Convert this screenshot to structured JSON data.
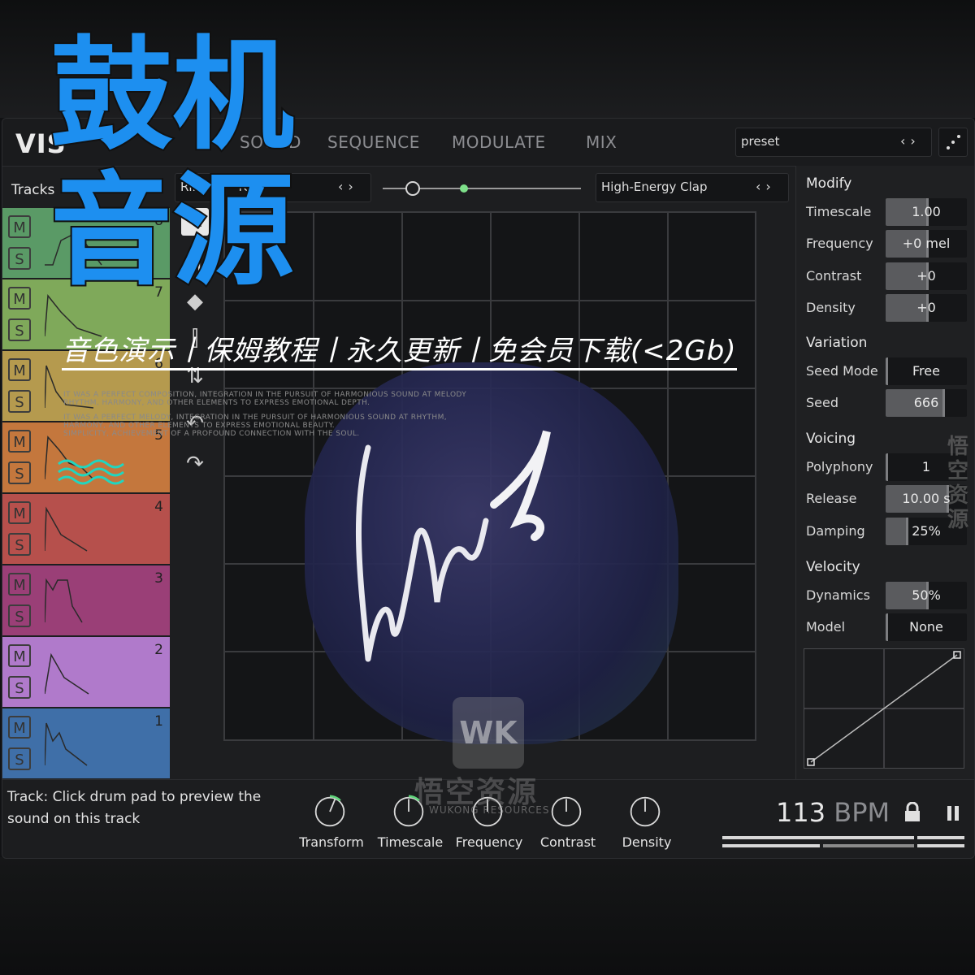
{
  "app": {
    "logo": "VIS",
    "tabs": [
      "SOUND",
      "SEQUENCE",
      "MODULATE",
      "MIX"
    ],
    "preset": {
      "value": "preset"
    }
  },
  "overlay": {
    "title_line1": "鼓机",
    "title_line2": "音源",
    "promo": "音色演示丨保姆教程丨永久更新丨免会员下载(<2Gb)",
    "small_text": [
      "IT WAS A PERFECT COMPOSITION, INTEGRATION IN THE PURSUIT OF HARMONIOUS SOUND AT MELODY",
      "RHYTHM, HARMONY, AND OTHER ELEMENTS TO EXPRESS EMOTIONAL DEPTH.",
      "IT WAS A PERFECT MELODY, INTEGRATION IN THE PURSUIT OF HARMONIOUS SOUND AT RHYTHM,",
      "HARMONY, AND OTHER ELEMENTS TO EXPRESS EMOTIONAL BEAUTY.",
      "SIMPLICITY, ACHIEVEMENT OF A PROFOUND CONNECTION WITH THE SOUL."
    ],
    "watermark_vertical": "悟空资源",
    "watermark_logo": "WK",
    "watermark_text": "悟空资源",
    "watermark_sub": "WUKONG RESOURCES"
  },
  "tracks": {
    "title": "Tracks",
    "items": [
      {
        "number": "8",
        "color": "#5a9a66",
        "mute": "M",
        "solo": "S"
      },
      {
        "number": "7",
        "color": "#7fa95a",
        "mute": "M",
        "solo": "S"
      },
      {
        "number": "6",
        "color": "#b59a4e",
        "mute": "M",
        "solo": "S"
      },
      {
        "number": "5",
        "color": "#c4773d",
        "mute": "M",
        "solo": "S"
      },
      {
        "number": "4",
        "color": "#b6504c",
        "mute": "M",
        "solo": "S"
      },
      {
        "number": "3",
        "color": "#9a3f77",
        "mute": "M",
        "solo": "S"
      },
      {
        "number": "2",
        "color": "#b07acb",
        "mute": "M",
        "solo": "S"
      },
      {
        "number": "1",
        "color": "#3f6fa8",
        "mute": "M",
        "solo": "S"
      }
    ]
  },
  "editor": {
    "left_sample": "Ring",
    "left_sample_suffix": "re",
    "right_sample": "High-Energy Clap"
  },
  "panel": {
    "modify": {
      "title": "Modify",
      "params": [
        {
          "label": "Timescale",
          "value": "1.00",
          "fill": 0.5
        },
        {
          "label": "Frequency",
          "value": "+0 mel",
          "fill": 0.5
        },
        {
          "label": "Contrast",
          "value": "+0",
          "fill": 0.5
        },
        {
          "label": "Density",
          "value": "+0",
          "fill": 0.5
        }
      ]
    },
    "variation": {
      "title": "Variation",
      "params": [
        {
          "label": "Seed Mode",
          "value": "Free",
          "fill": 0.0
        },
        {
          "label": "Seed",
          "value": "666",
          "fill": 0.7
        }
      ]
    },
    "voicing": {
      "title": "Voicing",
      "params": [
        {
          "label": "Polyphony",
          "value": "1",
          "fill": 0.0
        },
        {
          "label": "Release",
          "value": "10.00 s",
          "fill": 0.75
        },
        {
          "label": "Damping",
          "value": "25%",
          "fill": 0.25
        }
      ]
    },
    "velocity": {
      "title": "Velocity",
      "params": [
        {
          "label": "Dynamics",
          "value": "50%",
          "fill": 0.5
        },
        {
          "label": "Model",
          "value": "None",
          "fill": 0.0
        }
      ]
    }
  },
  "bottom": {
    "hint": "Track: Click drum pad to preview the sound on this track",
    "knobs": [
      "Transform",
      "Timescale",
      "Frequency",
      "Contrast",
      "Density"
    ],
    "bpm_value": "113",
    "bpm_unit": "BPM"
  }
}
